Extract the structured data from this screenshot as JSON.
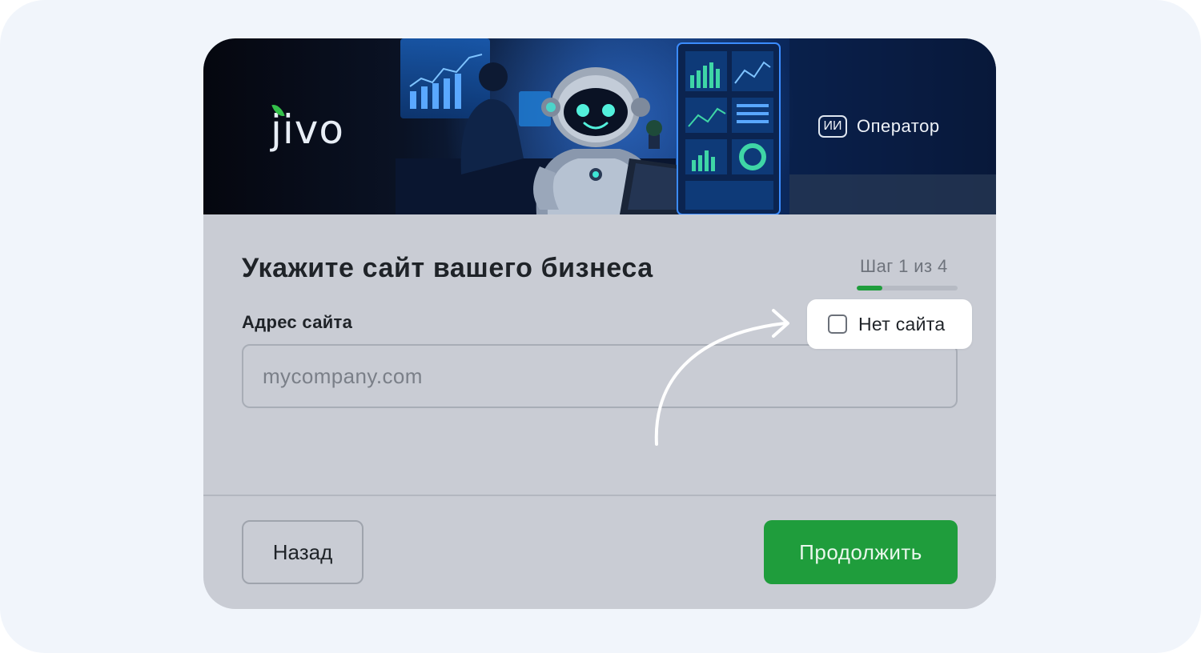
{
  "header": {
    "logo_text": "jivo",
    "mode_chip": "ИИ",
    "mode_label": "Оператор"
  },
  "form": {
    "title": "Укажите сайт вашего бизнеса",
    "step_text": "Шаг 1 из 4",
    "step_progress": 0.25,
    "field_label": "Адрес сайта",
    "url_placeholder": "mycompany.com",
    "url_value": "",
    "no_site_label": "Нет сайта",
    "no_site_checked": false
  },
  "footer": {
    "back_label": "Назад",
    "continue_label": "Продолжить"
  },
  "colors": {
    "accent": "#1f9d3c",
    "card_bg": "#c9ccd4",
    "page_bg": "#f1f5fb",
    "text": "#1f2328"
  },
  "icons": [
    "leaf-icon",
    "checkbox-icon",
    "arrow-icon"
  ]
}
